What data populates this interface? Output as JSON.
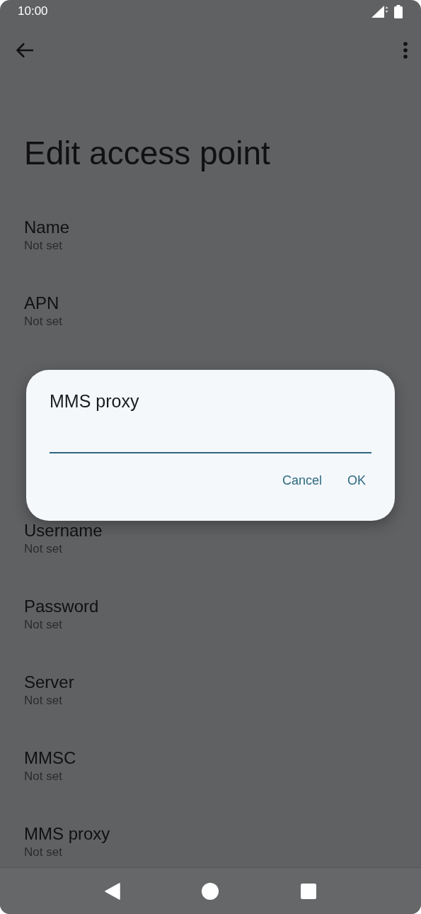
{
  "status_bar": {
    "time": "10:00"
  },
  "title": "Edit access point",
  "settings_above_dialog": [
    {
      "title": "Name",
      "value": "Not set"
    },
    {
      "title": "APN",
      "value": "Not set"
    }
  ],
  "settings_below_dialog": [
    {
      "title": "Username",
      "value": "Not set"
    },
    {
      "title": "Password",
      "value": "Not set"
    },
    {
      "title": "Server",
      "value": "Not set"
    },
    {
      "title": "MMSC",
      "value": "Not set"
    },
    {
      "title": "MMS proxy",
      "value": "Not set"
    }
  ],
  "dialog": {
    "title": "MMS proxy",
    "buttons": [
      "Cancel",
      "OK"
    ]
  }
}
